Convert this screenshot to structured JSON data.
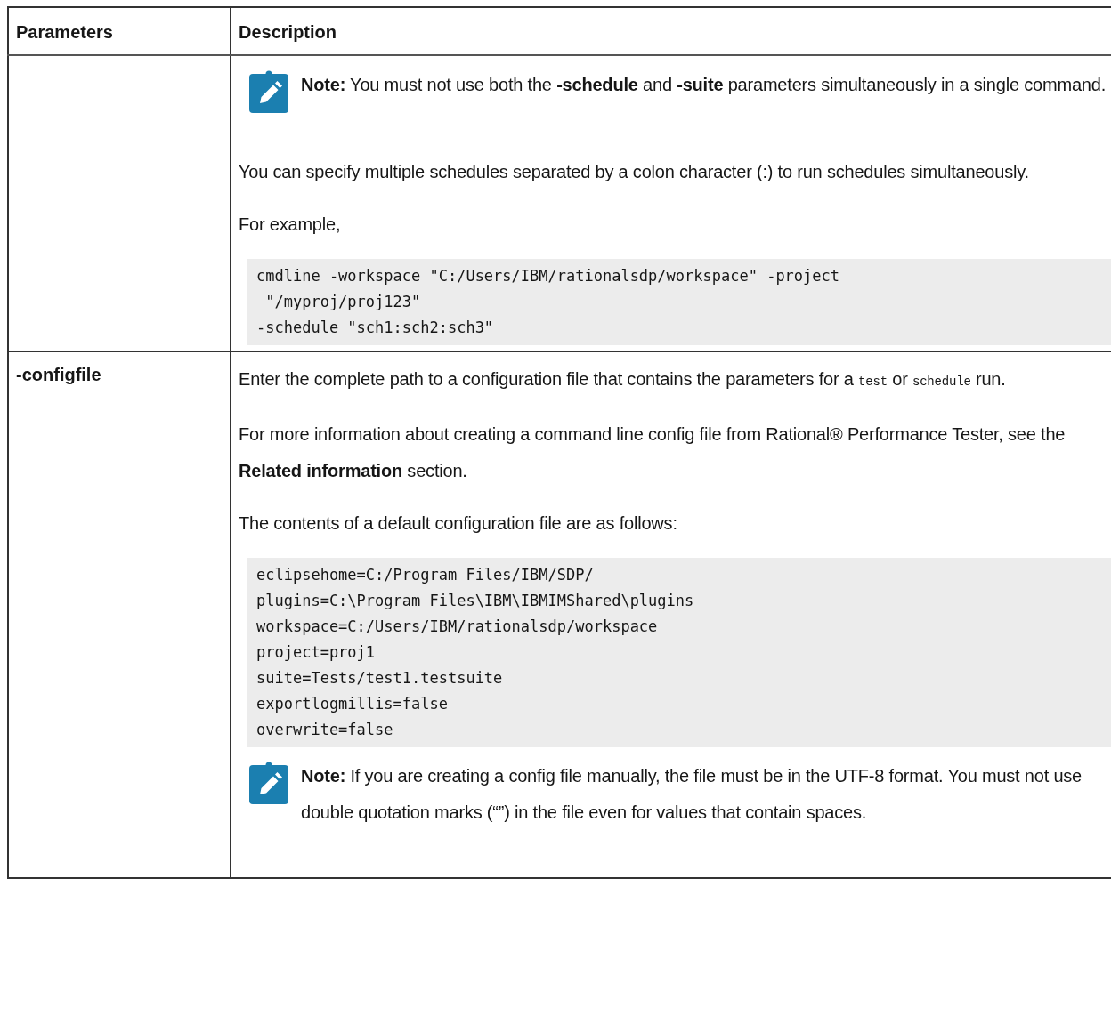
{
  "table": {
    "columns": [
      "Parameters",
      "Description"
    ],
    "rows": [
      {
        "parameter": "",
        "blocks": [
          {
            "kind": "note",
            "label": "Note:",
            "text": "You must not use both the **-schedule** and **-suite** parameters simultaneously in a single command."
          },
          {
            "kind": "para",
            "parts": [
              {
                "kind": "text",
                "text": "You can specify multiple schedules separated by a colon character (:) to run schedules simultaneously."
              }
            ]
          },
          {
            "kind": "para",
            "parts": [
              {
                "kind": "text",
                "text": "For example,"
              }
            ]
          },
          {
            "kind": "code",
            "lines": [
              "cmdline -workspace \"C:/Users/IBM/rationalsdp/workspace\" -project",
              " \"/myproj/proj123\"",
              "-schedule \"sch1:sch2:sch3\""
            ]
          }
        ]
      },
      {
        "parameter": "-configfile",
        "blocks": [
          {
            "kind": "para",
            "parts": [
              {
                "kind": "text",
                "text": "Enter the complete path to a configuration file that contains the parameters for a"
              },
              {
                "kind": "code",
                "text": "test"
              },
              {
                "kind": "text",
                "text": "or"
              },
              {
                "kind": "code",
                "text": "schedule"
              },
              {
                "kind": "text",
                "text": "run."
              }
            ]
          },
          {
            "kind": "para",
            "parts": [
              {
                "kind": "text",
                "text": "For more information about creating a command line config file from  Rational® Performance Tester, see the **Related information** section."
              }
            ]
          },
          {
            "kind": "para",
            "parts": [
              {
                "kind": "text",
                "text": "The contents of a default configuration file are as follows:"
              }
            ]
          },
          {
            "kind": "code",
            "lines": [
              "eclipsehome=C:/Program Files/IBM/SDP/",
              "plugins=C:\\Program Files\\IBM\\IBMIMShared\\plugins",
              "workspace=C:/Users/IBM/rationalsdp/workspace",
              "project=proj1",
              "suite=Tests/test1.testsuite",
              "exportlogmillis=false",
              "overwrite=false"
            ]
          },
          {
            "kind": "note",
            "label": "Note:",
            "text": "If you are creating a config file manually, the file must be in the UTF-8 format. You must not use double quotation marks (“”) in the file even for values that contain spaces."
          }
        ]
      }
    ]
  }
}
